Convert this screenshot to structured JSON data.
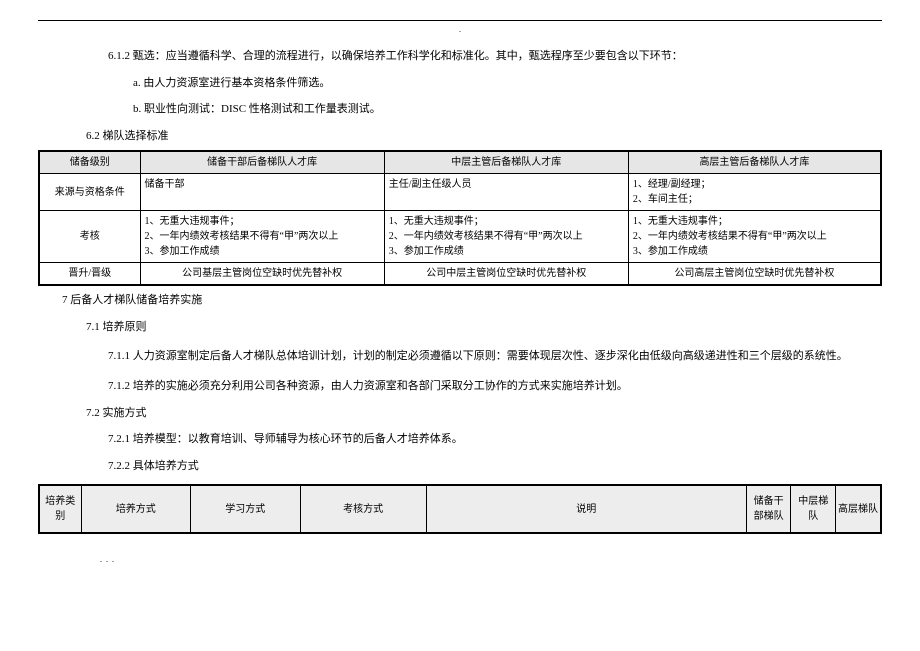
{
  "p_6_1_2": "6.1.2 甄选：应当遵循科学、合理的流程进行，以确保培养工作科学化和标准化。其中，甄选程序至少要包含以下环节：",
  "p_a": "a. 由人力资源室进行基本资格条件筛选。",
  "p_b": "b. 职业性向测试：DISC 性格测试和工作量表测试。",
  "sect_6_2": "6.2 梯队选择标准",
  "t1": {
    "h0": "储备级别",
    "h1": "储备干部后备梯队人才库",
    "h2": "中层主管后备梯队人才库",
    "h3": "高层主管后备梯队人才库",
    "r1_h": "来源与资格条件",
    "r1_c1": "储备干部",
    "r1_c2": "主任/副主任级人员",
    "r1_c3": "1、经理/副经理；\n2、车间主任；",
    "r2_h": "考核",
    "r2_c1": "1、无重大违规事件；\n2、一年内绩效考核结果不得有“甲”两次以上\n3、参加工作成绩",
    "r2_c2": "1、无重大违规事件；\n2、一年内绩效考核结果不得有“甲”两次以上\n3、参加工作成绩",
    "r2_c3": "1、无重大违规事件；\n2、一年内绩效考核结果不得有“甲”两次以上\n3、参加工作成绩",
    "r3_h": "晋升/晋级",
    "r3_c1": "公司基层主管岗位空缺时优先替补权",
    "r3_c2": "公司中层主管岗位空缺时优先替补权",
    "r3_c3": "公司高层主管岗位空缺时优先替补权"
  },
  "sect_7": "7 后备人才梯队储备培养实施",
  "sect_7_1": "7.1 培养原则",
  "p_7_1_1": "7.1.1 人力资源室制定后备人才梯队总体培训计划，计划的制定必须遵循以下原则：需要体现层次性、逐步深化由低级向高级递进性和三个层级的系统性。",
  "p_7_1_2": "7.1.2 培养的实施必须充分利用公司各种资源，由人力资源室和各部门采取分工协作的方式来实施培养计划。",
  "sect_7_2": "7.2 实施方式",
  "p_7_2_1": "7.2.1 培养模型：以教育培训、导师辅导为核心环节的后备人才培养体系。",
  "p_7_2_2": "7.2.2 具体培养方式",
  "t2": {
    "h0": "培养类别",
    "h1": "培养方式",
    "h2": "学习方式",
    "h3": "考核方式",
    "h4": "说明",
    "h5": "储备干部梯队",
    "h6": "中层梯队",
    "h7": "高层梯队"
  }
}
